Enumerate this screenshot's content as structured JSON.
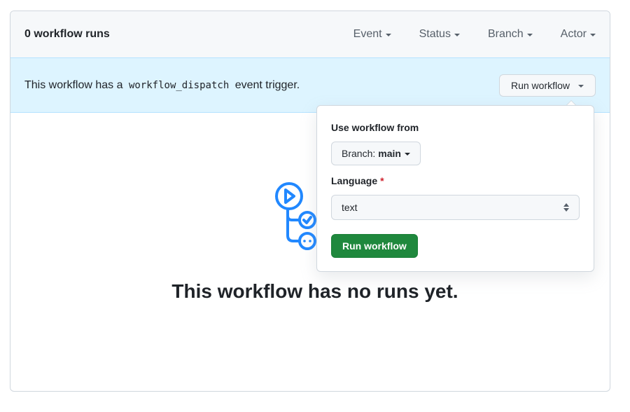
{
  "header": {
    "run_count": "0 workflow runs",
    "filters": [
      {
        "label": "Event"
      },
      {
        "label": "Status"
      },
      {
        "label": "Branch"
      },
      {
        "label": "Actor"
      }
    ]
  },
  "banner": {
    "prefix": "This workflow has a",
    "code": "workflow_dispatch",
    "suffix": "event trigger.",
    "run_button": "Run workflow"
  },
  "popover": {
    "use_from_label": "Use workflow from",
    "branch_prefix": "Branch:",
    "branch_value": "main",
    "language_label": "Language",
    "required_mark": "*",
    "language_value": "text",
    "submit_label": "Run workflow"
  },
  "empty_state": {
    "icon": "workflow-icon",
    "title": "This workflow has no runs yet."
  },
  "colors": {
    "accent": "#2188ff",
    "primary_button": "#1f883d",
    "banner_bg": "#ddf4ff",
    "required": "#cf222e"
  }
}
